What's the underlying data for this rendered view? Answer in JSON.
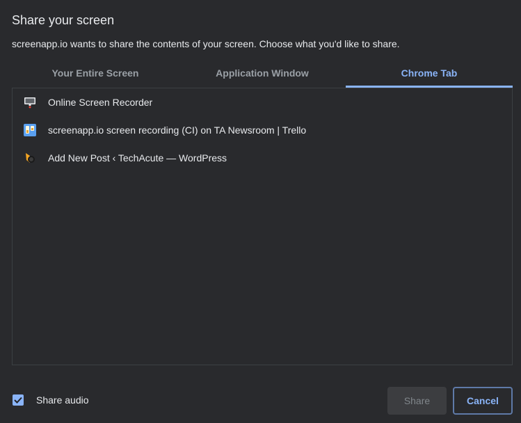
{
  "dialog": {
    "title": "Share your screen",
    "subtitle": "screenapp.io wants to share the contents of your screen. Choose what you'd like to share."
  },
  "tabs": [
    {
      "label": "Your Entire Screen",
      "active": false
    },
    {
      "label": "Application Window",
      "active": false
    },
    {
      "label": "Chrome Tab",
      "active": true
    }
  ],
  "items": [
    {
      "label": "Online Screen Recorder",
      "icon": "screen-recorder-icon"
    },
    {
      "label": "screenapp.io screen recording (CI) on TA Newsroom | Trello",
      "icon": "trello-icon"
    },
    {
      "label": "Add New Post ‹ TechAcute — WordPress",
      "icon": "techacute-icon"
    }
  ],
  "footer": {
    "audio_label": "Share audio",
    "audio_checked": true,
    "share_label": "Share",
    "cancel_label": "Cancel"
  },
  "colors": {
    "background": "#292a2d",
    "accent": "#8ab4f8",
    "text": "#e8eaed",
    "muted": "#9aa0a6"
  }
}
